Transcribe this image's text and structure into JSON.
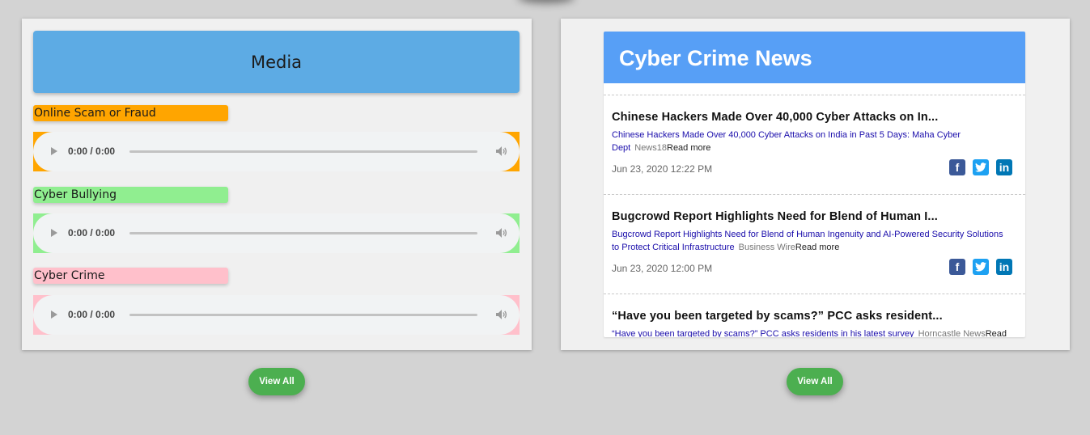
{
  "media": {
    "header": "Media",
    "categories": [
      {
        "label": "Online Scam or Fraud",
        "color": "#ffa500",
        "player": {
          "time": "0:00 / 0:00"
        }
      },
      {
        "label": "Cyber Bullying",
        "color": "#90ee90",
        "player": {
          "time": "0:00 / 0:00"
        }
      },
      {
        "label": "Cyber Crime",
        "color": "#ffc0cb",
        "player": {
          "time": "0:00 / 0:00"
        }
      }
    ],
    "view_all_label": "View All"
  },
  "news": {
    "header": "Cyber Crime News",
    "items": [
      {
        "title": "Chinese Hackers Made Over 40,000 Cyber Attacks on In...",
        "snippet": "Chinese Hackers Made Over 40,000 Cyber Attacks on India in Past 5 Days: Maha Cyber Dept",
        "source": "News18",
        "read_more": "Read more",
        "date": "Jun 23, 2020 12:22 PM"
      },
      {
        "title": "Bugcrowd Report Highlights Need for Blend of Human I...",
        "snippet": "Bugcrowd Report Highlights Need for Blend of Human Ingenuity and AI-Powered Security Solutions to Protect Critical Infrastructure",
        "source": "Business Wire",
        "read_more": "Read more",
        "date": "Jun 23, 2020 12:00 PM"
      },
      {
        "title": "“Have you been targeted by scams?” PCC asks resident...",
        "snippet": "“Have you been targeted by scams?” PCC asks residents in his latest survey",
        "source": "Horncastle News",
        "read_more": "Read more",
        "date": ""
      }
    ],
    "social_icons": [
      "facebook-icon",
      "twitter-icon",
      "linkedin-icon"
    ],
    "view_all_label": "View All"
  },
  "colors": {
    "media_header": "#5dabe4",
    "news_header": "#579ff6",
    "button": "#4caf50",
    "link": "#1a0dab"
  }
}
